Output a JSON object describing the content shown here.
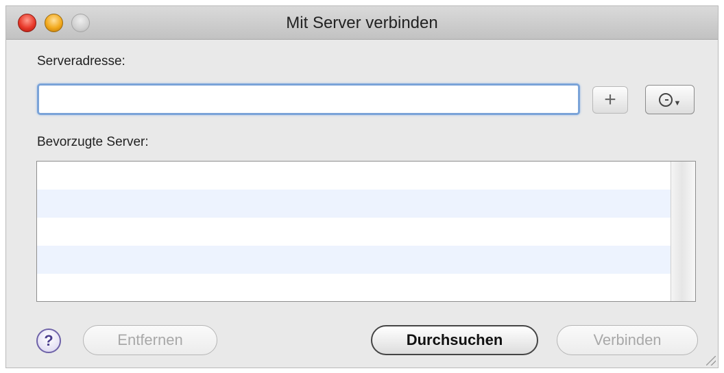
{
  "window": {
    "title": "Mit Server verbinden"
  },
  "form": {
    "address_label": "Serveradresse:",
    "address_value": "",
    "add_button_label": "+",
    "recent_icon": "clock-icon"
  },
  "favorites": {
    "label": "Bevorzugte Server:",
    "items": []
  },
  "buttons": {
    "help_label": "?",
    "remove_label": "Entfernen",
    "browse_label": "Durchsuchen",
    "connect_label": "Verbinden"
  },
  "colors": {
    "focus_ring": "#7aa3d8",
    "alt_row": "#edf3fe",
    "close": "#e8392a",
    "minimize": "#f2a91c"
  }
}
